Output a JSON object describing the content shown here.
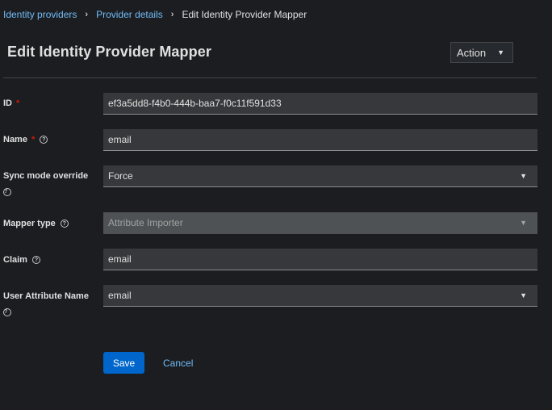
{
  "breadcrumb": {
    "items": [
      "Identity providers",
      "Provider details"
    ],
    "current": "Edit Identity Provider Mapper"
  },
  "header": {
    "title": "Edit Identity Provider Mapper",
    "action_label": "Action"
  },
  "form": {
    "id": {
      "label": "ID",
      "required": "*",
      "value": "ef3a5dd8-f4b0-444b-baa7-f0c11f591d33"
    },
    "name": {
      "label": "Name",
      "required": "*",
      "value": "email"
    },
    "sync_mode": {
      "label": "Sync mode override",
      "value": "Force"
    },
    "mapper_type": {
      "label": "Mapper type",
      "value": "Attribute Importer",
      "disabled": true
    },
    "claim": {
      "label": "Claim",
      "value": "email"
    },
    "user_attribute": {
      "label": "User Attribute Name",
      "value": "email"
    }
  },
  "buttons": {
    "save": "Save",
    "cancel": "Cancel"
  },
  "colors": {
    "background": "#1b1d21",
    "link": "#73bcf7",
    "primary": "#0066cc",
    "required": "#c9190b"
  }
}
